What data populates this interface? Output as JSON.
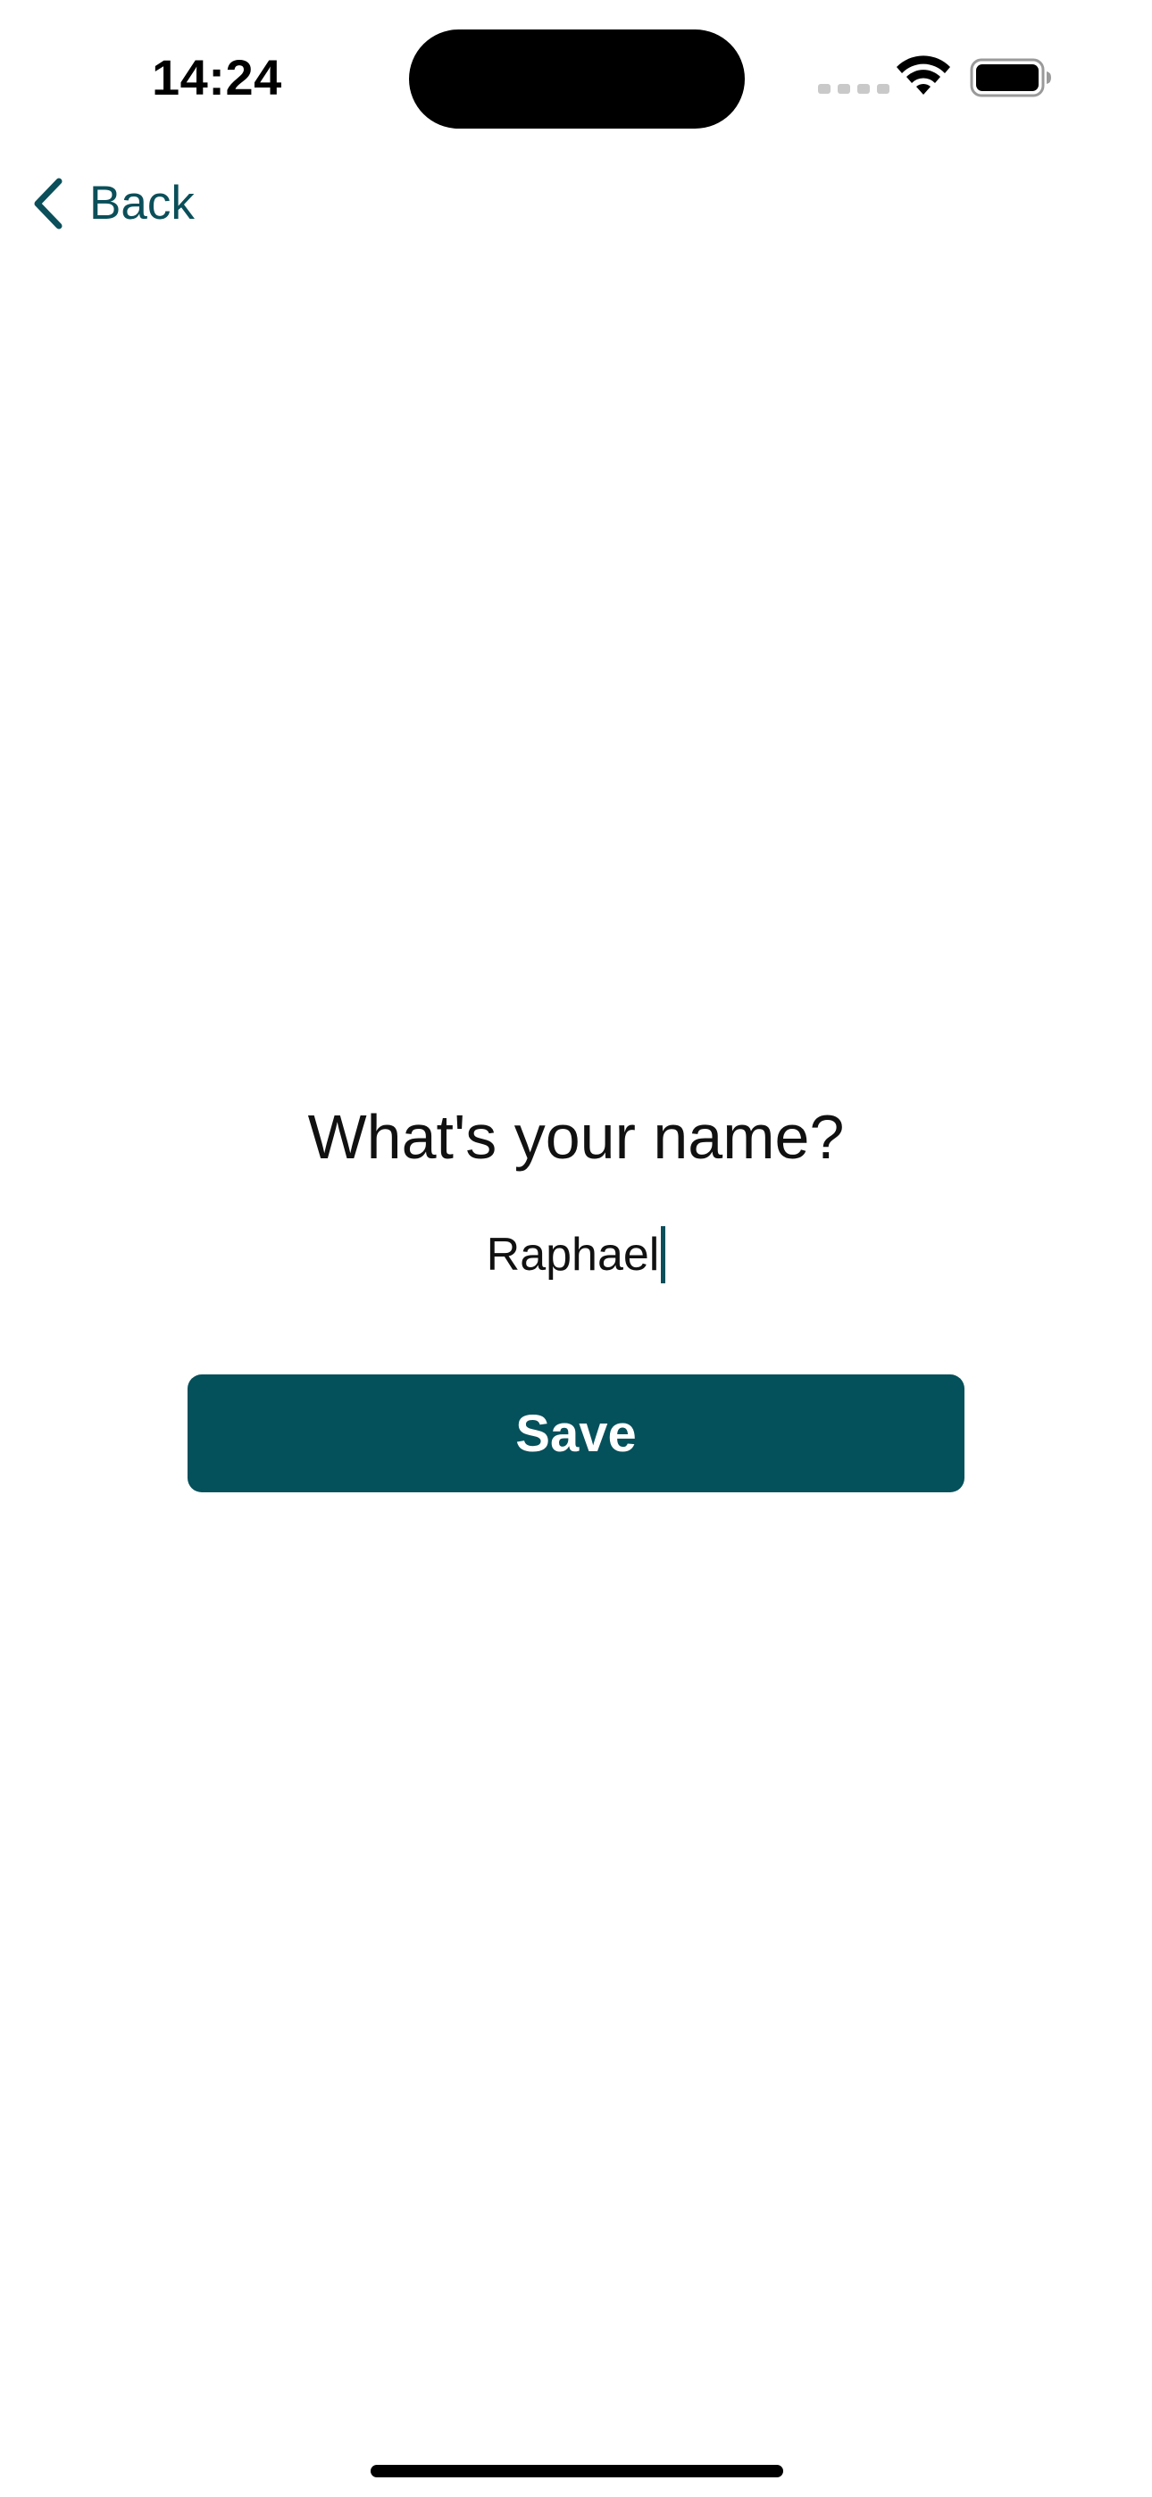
{
  "status_bar": {
    "time": "14:24",
    "wifi_icon": "wifi-icon",
    "battery_icon": "battery-icon",
    "signal_icon": "signal-dots-icon"
  },
  "navigation": {
    "back_label": "Back",
    "back_icon": "chevron-left-icon"
  },
  "form": {
    "question": "What's your name?",
    "name_value": "Raphael",
    "save_label": "Save"
  },
  "colors": {
    "accent": "#04505b",
    "link": "#0a4f5a",
    "background": "#ffffff"
  }
}
